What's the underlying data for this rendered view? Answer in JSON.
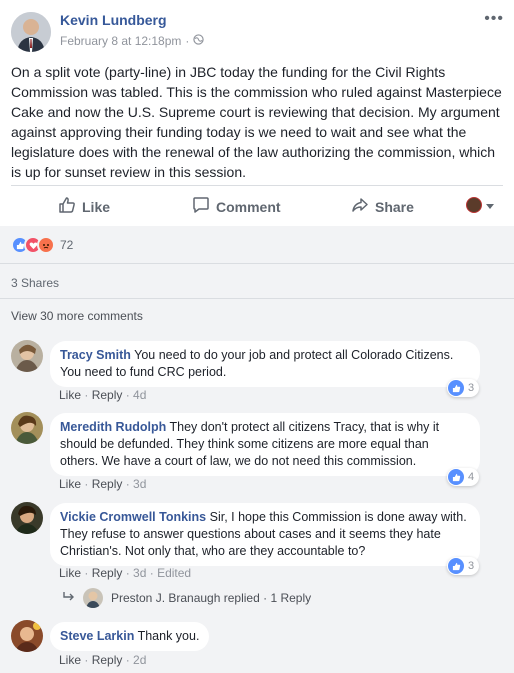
{
  "post": {
    "author": "Kevin Lundberg",
    "timestamp": "February 8 at 12:18pm",
    "text": "On a split vote (party-line) in JBC today the funding for the Civil Rights Commission was tabled. This is the commission who ruled against Masterpiece Cake and now the U.S. Supreme court is reviewing that decision. My argument against approving their funding today is we need to wait and see what the legislature does with the renewal of the law authorizing the commission, which is up for sunset review in this session.",
    "more_icon": "ellipsis-icon",
    "audience_icon": "globe-icon"
  },
  "actions": {
    "like": "Like",
    "comment": "Comment",
    "share": "Share"
  },
  "reactions": {
    "count": "72",
    "types": [
      "like",
      "love",
      "angry"
    ]
  },
  "shares": "3 Shares",
  "view_more": "View 30 more comments",
  "comments": [
    {
      "name": "Tracy Smith",
      "text": "You need to do your job and protect all Colorado Citizens. You need to fund CRC period.",
      "like": "Like",
      "reply": "Reply",
      "time": "4d",
      "likes": "3"
    },
    {
      "name": "Meredith Rudolph",
      "text": "They don't protect all citizens Tracy, that is why it should be defunded. They think some citizens are more equal than others. We have a court of law, we do not need this commission.",
      "like": "Like",
      "reply": "Reply",
      "time": "3d",
      "likes": "4"
    },
    {
      "name": "Vickie Cromwell Tonkins",
      "text": "Sir, I hope this Commission is done away with. They refuse to answer questions about cases and it seems they hate Christian's. Not only that, who are they accountable to?",
      "like": "Like",
      "reply": "Reply",
      "time": "3d",
      "edited": "Edited",
      "likes": "3"
    },
    {
      "name": "Steve Larkin",
      "text": "Thank you.",
      "like": "Like",
      "reply": "Reply",
      "time": "2d"
    }
  ],
  "reply_summary": {
    "name": "Preston J. Branaugh",
    "replied": "replied",
    "count": "1 Reply"
  },
  "colors": {
    "link": "#365899",
    "like_blue": "#5890ff",
    "gray_bg": "#f2f3f5"
  }
}
